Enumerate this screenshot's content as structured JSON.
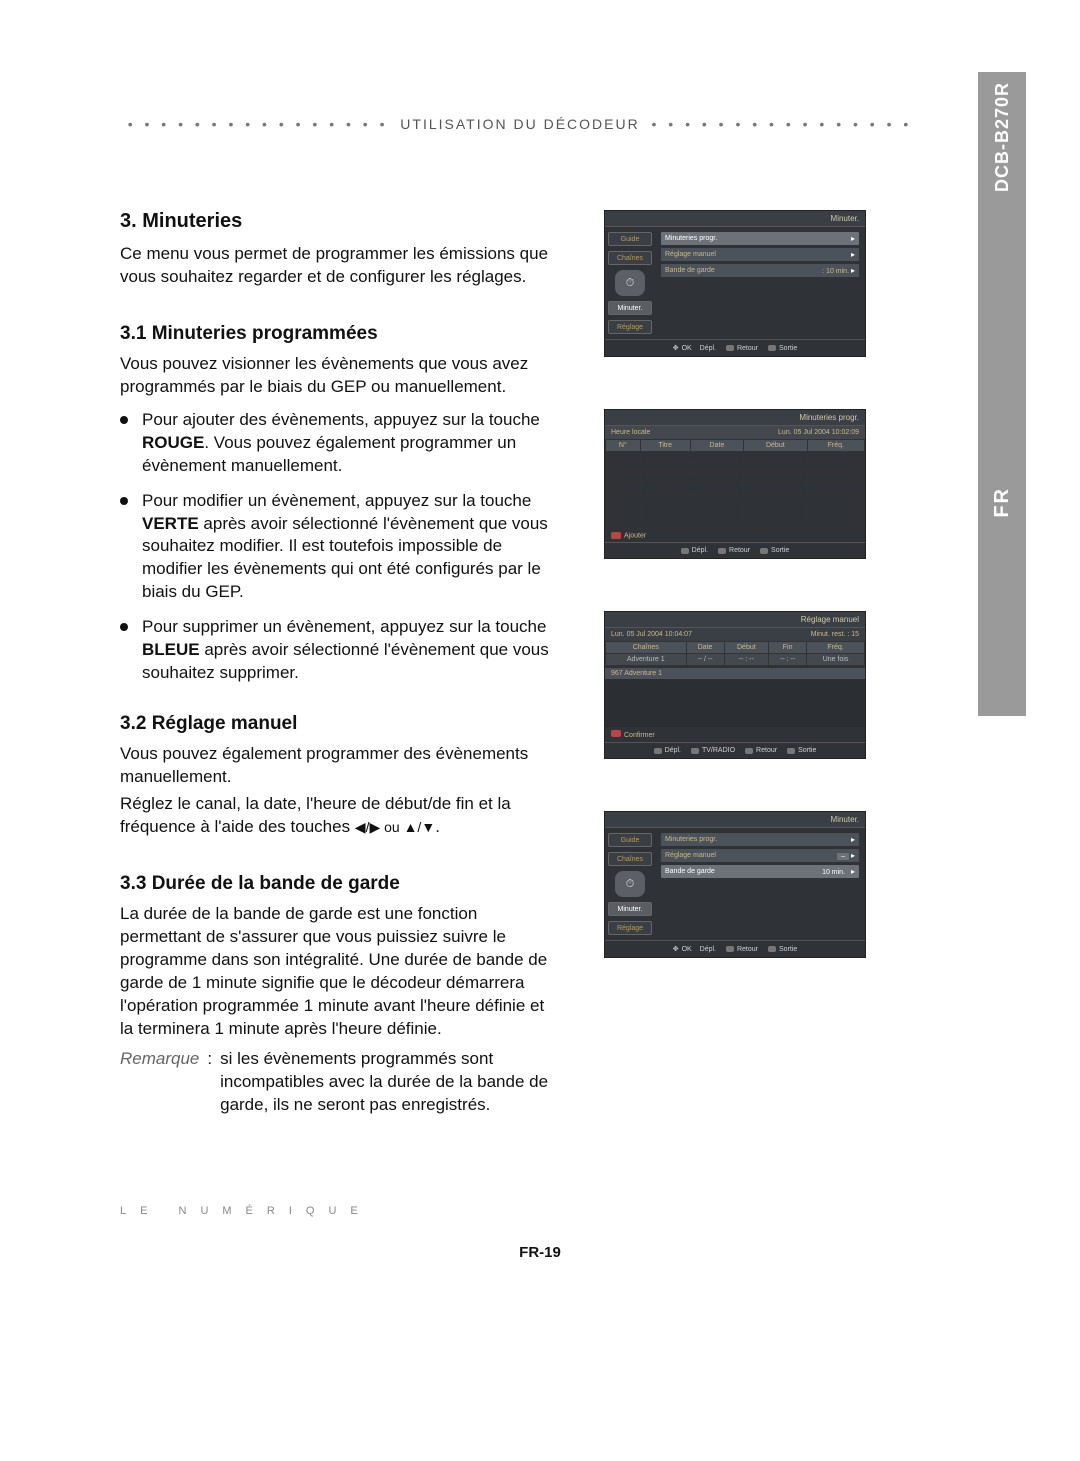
{
  "model": "DCB-B270R",
  "lang": "FR",
  "header": {
    "dots_left": "• • • • • • • • • • • • • • • •",
    "title": "UTILISATION DU DÉCODEUR",
    "dots_right": "• • • • • • • • • • • • • • • •"
  },
  "h1": "3. Minuteries",
  "p1": "Ce menu vous permet de programmer les émissions que vous souhaitez regarder et de configurer les réglages.",
  "h2_1": "3.1 Minuteries programmées",
  "p2": "Vous pouvez visionner les évènements que vous avez programmés par le biais du GEP ou manuellement.",
  "bullets": [
    {
      "pre": "Pour ajouter des évènements, appuyez sur la touche ",
      "strong": "ROUGE",
      "post": ". Vous pouvez également programmer un évènement manuellement."
    },
    {
      "pre": "Pour modifier un évènement, appuyez sur la touche ",
      "strong": "VERTE",
      "post": " après avoir sélectionné l'évènement que vous souhaitez modifier. Il est toutefois impossible de modifier les évènements qui ont été configurés par le biais du GEP."
    },
    {
      "pre": "Pour supprimer un évènement, appuyez sur la touche ",
      "strong": "BLEUE",
      "post": " après avoir sélectionné l'évènement que vous souhaitez supprimer."
    }
  ],
  "h2_2": "3.2 Réglage manuel",
  "p3": "Vous pouvez également programmer des évènements manuellement.",
  "p4_pre": "Réglez le canal, la date, l'heure de début/de fin et la fréquence à l'aide des touches ",
  "p4_arrows": "◀/▶ ou ▲/▼",
  "p4_post": ".",
  "h2_3": "3.3 Durée de la bande de garde",
  "p5": "La durée de la bande de garde est une fonction permettant de s'assurer que vous puissiez suivre le programme dans son intégralité. Une durée de bande de garde de 1 minute signifie que le décodeur démarrera l'opération programmée 1 minute avant l'heure définie et la terminera 1 minute après l'heure définie.",
  "note_label": "Remarque",
  "note_colon": ":",
  "note_body": "si les évènements programmés sont incompatibles avec la durée de la bande de garde, ils ne seront pas enregistrés.",
  "footer_brand": "LE NUMÉRIQUE",
  "page_number": "FR-19",
  "fig1": {
    "title": "Minuter.",
    "side": {
      "guide": "Guide",
      "chaines": "Chaînes",
      "minuter": "Minuter.",
      "reglage": "Réglage"
    },
    "rows": [
      {
        "label": "Minuteries progr.",
        "val": "",
        "sel": true
      },
      {
        "label": "Réglage manuel",
        "val": ""
      },
      {
        "label": "Bande de garde",
        "val": ": 10 min."
      }
    ],
    "bottom": {
      "ok": "OK",
      "depl": "Dépl.",
      "retour": "Retour",
      "sortie": "Sortie"
    }
  },
  "fig2": {
    "title": "Minuteries progr.",
    "hdr": {
      "heure": "Heure locale",
      "date": "Lun. 05 Jul 2004 10:02:09"
    },
    "cols": [
      "N°",
      "Titre",
      "Date",
      "Début",
      "Fréq."
    ],
    "add": "Ajouter",
    "bottom": {
      "depl": "Dépl.",
      "retour": "Retour",
      "sortie": "Sortie"
    }
  },
  "fig3": {
    "title": "Réglage manuel",
    "hdr": {
      "date": "Lun. 05 Jul 2004 10:04:07",
      "rest": "Minut. rest. : 15"
    },
    "cols": [
      "Chaînes",
      "Date",
      "Début",
      "Fin",
      "Fréq."
    ],
    "row": {
      "ch": "Adventure 1",
      "date": "-- / --",
      "deb": "-- : --",
      "fin": "-- : --",
      "freq": "Une fois"
    },
    "line": "967 Adventure 1",
    "confirm": "Confirmer",
    "bottom": {
      "depl": "Dépl.",
      "tvradio": "TV/RADIO",
      "retour": "Retour",
      "sortie": "Sortie"
    }
  },
  "fig4": {
    "title": "Minuter.",
    "side": {
      "guide": "Guide",
      "chaines": "Chaînes",
      "minuter": "Minuter.",
      "reglage": "Réglage"
    },
    "rows": [
      {
        "label": "Minuteries progr.",
        "val": ""
      },
      {
        "label": "Réglage manuel",
        "val": "–"
      },
      {
        "label": "Bande de garde",
        "val": "10 min.",
        "sel": true
      }
    ],
    "bottom": {
      "ok": "OK",
      "depl": "Dépl.",
      "retour": "Retour",
      "sortie": "Sortie"
    }
  }
}
